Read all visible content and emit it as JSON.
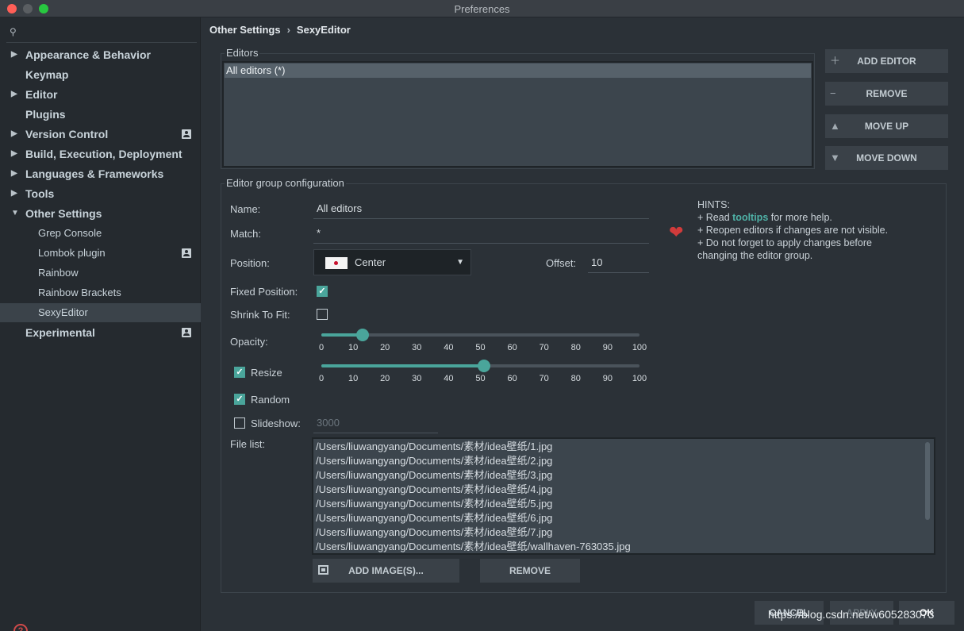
{
  "window": {
    "title": "Preferences"
  },
  "sidebar": {
    "search_icon": "search-icon",
    "items": [
      {
        "label": "Appearance & Behavior",
        "expandable": true
      },
      {
        "label": "Keymap"
      },
      {
        "label": "Editor",
        "expandable": true
      },
      {
        "label": "Plugins"
      },
      {
        "label": "Version Control",
        "expandable": true,
        "project_icon": true
      },
      {
        "label": "Build, Execution, Deployment",
        "expandable": true
      },
      {
        "label": "Languages & Frameworks",
        "expandable": true
      },
      {
        "label": "Tools",
        "expandable": true
      },
      {
        "label": "Other Settings",
        "expanded": true
      },
      {
        "label": "Grep Console"
      },
      {
        "label": "Lombok plugin",
        "project_icon": true
      },
      {
        "label": "Rainbow"
      },
      {
        "label": "Rainbow Brackets"
      },
      {
        "label": "SexyEditor",
        "selected": true
      },
      {
        "label": "Experimental",
        "project_icon": true
      }
    ]
  },
  "breadcrumb": {
    "parent": "Other Settings",
    "separator": "›",
    "current": "SexyEditor"
  },
  "editors": {
    "legend": "Editors",
    "items": [
      "All editors (*)"
    ],
    "buttons": {
      "add": "ADD EDITOR",
      "remove": "REMOVE",
      "move_up": "MOVE UP",
      "move_down": "MOVE DOWN"
    }
  },
  "config": {
    "legend": "Editor group configuration",
    "name_label": "Name:",
    "name_value": "All editors",
    "match_label": "Match:",
    "match_value": "*",
    "position_label": "Position:",
    "position_value": "Center",
    "offset_label": "Offset:",
    "offset_value": "10",
    "fixed_position_label": "Fixed Position:",
    "fixed_position_checked": true,
    "shrink_label": "Shrink To Fit:",
    "shrink_checked": false,
    "opacity_label": "Opacity:",
    "opacity_value": 13,
    "resize_label": "Resize",
    "resize_checked": true,
    "resize_value": 51,
    "random_label": "Random",
    "random_checked": true,
    "slideshow_label": "Slideshow:",
    "slideshow_checked": false,
    "slideshow_placeholder": "3000",
    "slider_ticks": [
      "0",
      "10",
      "20",
      "30",
      "40",
      "50",
      "60",
      "70",
      "80",
      "90",
      "100"
    ],
    "file_list_label": "File list:",
    "files": [
      "/Users/liuwangyang/Documents/素材/idea壁纸/1.jpg",
      "/Users/liuwangyang/Documents/素材/idea壁纸/2.jpg",
      "/Users/liuwangyang/Documents/素材/idea壁纸/3.jpg",
      "/Users/liuwangyang/Documents/素材/idea壁纸/4.jpg",
      "/Users/liuwangyang/Documents/素材/idea壁纸/5.jpg",
      "/Users/liuwangyang/Documents/素材/idea壁纸/6.jpg",
      "/Users/liuwangyang/Documents/素材/idea壁纸/7.jpg",
      "/Users/liuwangyang/Documents/素材/idea壁纸/wallhaven-763035.jpg"
    ],
    "add_images": "ADD IMAGE(S)...",
    "remove_images": "REMOVE"
  },
  "hints": {
    "title": "HINTS:",
    "line1_prefix": "+ Read ",
    "line1_link": "tooltips",
    "line1_suffix": " for more help.",
    "line2": "+ Reopen editors if changes are not visible.",
    "line3": "+ Do not forget to apply changes before",
    "line4": "changing the editor group."
  },
  "footer": {
    "cancel": "CANCEL",
    "apply": "APPLY",
    "ok": "OK",
    "watermark": "https://blog.csdn.net/w605283073"
  },
  "colors": {
    "accent": "#4aa59b",
    "background": "#2b3137",
    "sidebar": "#252a2f"
  }
}
